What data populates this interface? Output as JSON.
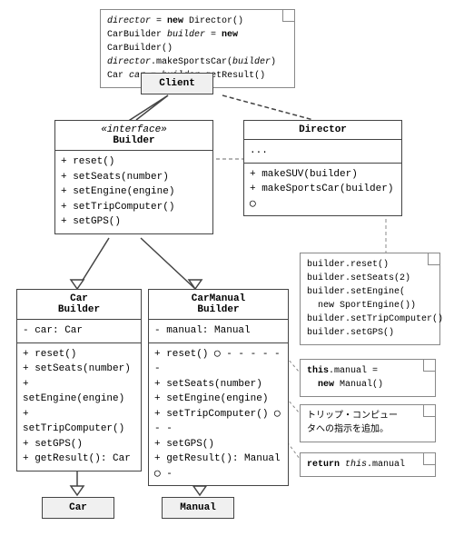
{
  "code_note": {
    "lines": [
      "director = new Director()",
      "CarBuilder builder = new CarBuilder()",
      "director.makeSportsCar(builder)",
      "Car car = builder.getResult()"
    ]
  },
  "client": {
    "label": "Client"
  },
  "builder": {
    "stereotype": "«interface»",
    "title": "Builder",
    "methods": [
      "+ reset()",
      "+ setSeats(number)",
      "+ setEngine(engine)",
      "+ setTripComputer()",
      "+ setGPS()"
    ]
  },
  "director": {
    "title": "Director",
    "fields": [
      "..."
    ],
    "methods": [
      "+ makeSUV(builder)",
      "+ makeSportsCar(builder)"
    ]
  },
  "car_builder": {
    "title": "Car\nBuilder",
    "fields": [
      "- car: Car"
    ],
    "methods": [
      "+ reset()",
      "+ setSeats(number)",
      "+ setEngine(engine)",
      "+ setTripComputer()",
      "+ setGPS()",
      "+ getResult(): Car"
    ]
  },
  "car_manual_builder": {
    "title": "CarManual\nBuilder",
    "fields": [
      "- manual: Manual"
    ],
    "methods": [
      "+ reset()",
      "+ setSeats(number)",
      "+ setEngine(engine)",
      "+ setTripComputer()",
      "+ setGPS()",
      "+ getResult(): Manual"
    ]
  },
  "car": {
    "label": "Car"
  },
  "manual": {
    "label": "Manual"
  },
  "note1": {
    "lines": [
      "builder.reset()",
      "builder.setSeats(2)",
      "builder.setEngine(",
      "  new SportEngine())",
      "builder.setTripComputer()",
      "builder.setGPS()"
    ]
  },
  "note2": {
    "lines": [
      "this.manual =",
      "  new Manual()"
    ]
  },
  "note3": {
    "lines": [
      "トリップ・コンピュー",
      "タへの指示を追加。"
    ]
  },
  "note4": {
    "lines": [
      "return this.manual"
    ]
  }
}
